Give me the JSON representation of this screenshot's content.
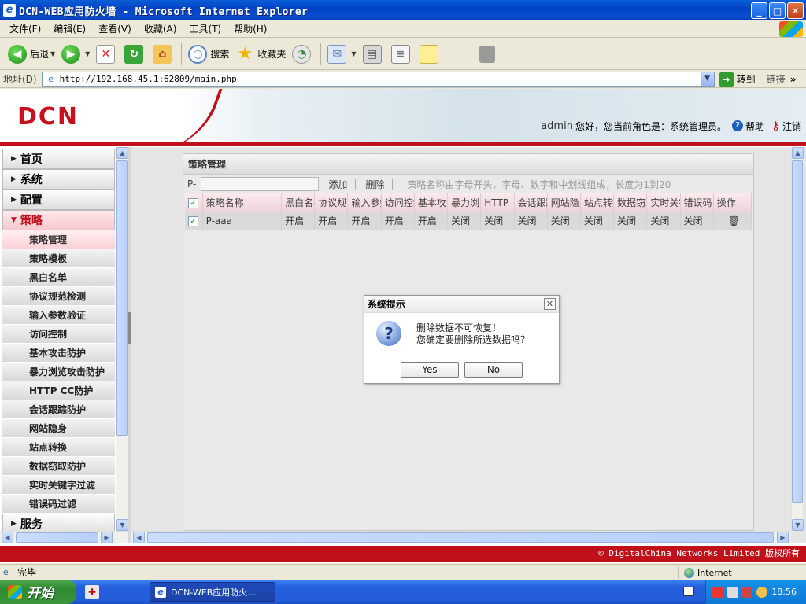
{
  "window": {
    "title": "DCN-WEB应用防火墙 - Microsoft Internet Explorer",
    "minimize": "_",
    "maximize": "□",
    "close": "✕"
  },
  "menu": [
    "文件(F)",
    "编辑(E)",
    "查看(V)",
    "收藏(A)",
    "工具(T)",
    "帮助(H)"
  ],
  "toolbar": {
    "back_label": "后退",
    "search_label": "搜索",
    "favorites_label": "收藏夹"
  },
  "address": {
    "label": "地址(D)",
    "url": "http://192.168.45.1:62809/main.php",
    "go_label": "转到",
    "links_label": "链接"
  },
  "header": {
    "logo": "DCN",
    "user": "admin",
    "greeting": "您好，您当前角色是：系统管理员。",
    "help": "帮助",
    "logout": "注销"
  },
  "nav": {
    "top_items": [
      "首页",
      "系统",
      "配置"
    ],
    "open_item": "策略",
    "sub_items": [
      "策略管理",
      "策略模板",
      "黑白名单",
      "协议规范检测",
      "输入参数验证",
      "访问控制",
      "基本攻击防护",
      "暴力浏览攻击防护",
      "HTTP CC防护",
      "会话跟踪防护",
      "网站隐身",
      "站点转换",
      "数据窃取防护",
      "实时关键字过滤",
      "错误码过滤"
    ],
    "active_sub": 0,
    "bottom_item": "服务"
  },
  "panel": {
    "title": "策略管理",
    "prefix": "P-",
    "add_label": "添加",
    "delete_label": "删除",
    "hint": "策略名称由字母开头，字母、数字和中划线组成，长度为1到20",
    "columns": [
      "策略名称",
      "黑白名单",
      "协议规范",
      "输入参数",
      "访问控制",
      "基本攻击",
      "暴力浏览",
      "HTTP",
      "会话跟踪",
      "网站隐身",
      "站点转换",
      "数据窃取",
      "实时关键",
      "错误码",
      "操作"
    ],
    "rows": [
      {
        "name": "P-aaa",
        "values": [
          "开启",
          "开启",
          "开启",
          "开启",
          "开启",
          "关闭",
          "关闭",
          "关闭",
          "关闭",
          "关闭",
          "关闭",
          "关闭",
          "关闭"
        ]
      }
    ]
  },
  "dialog": {
    "title": "系统提示",
    "line1": "删除数据不可恢复！",
    "line2": "您确定要删除所选数据吗？",
    "yes": "Yes",
    "no": "No"
  },
  "footer": {
    "copyright": "© DigitalChina Networks Limited 版权所有"
  },
  "status": {
    "text": "完毕",
    "zone": "Internet"
  },
  "taskbar": {
    "start": "开始",
    "task": "DCN-WEB应用防火...",
    "clock": "18:56"
  }
}
